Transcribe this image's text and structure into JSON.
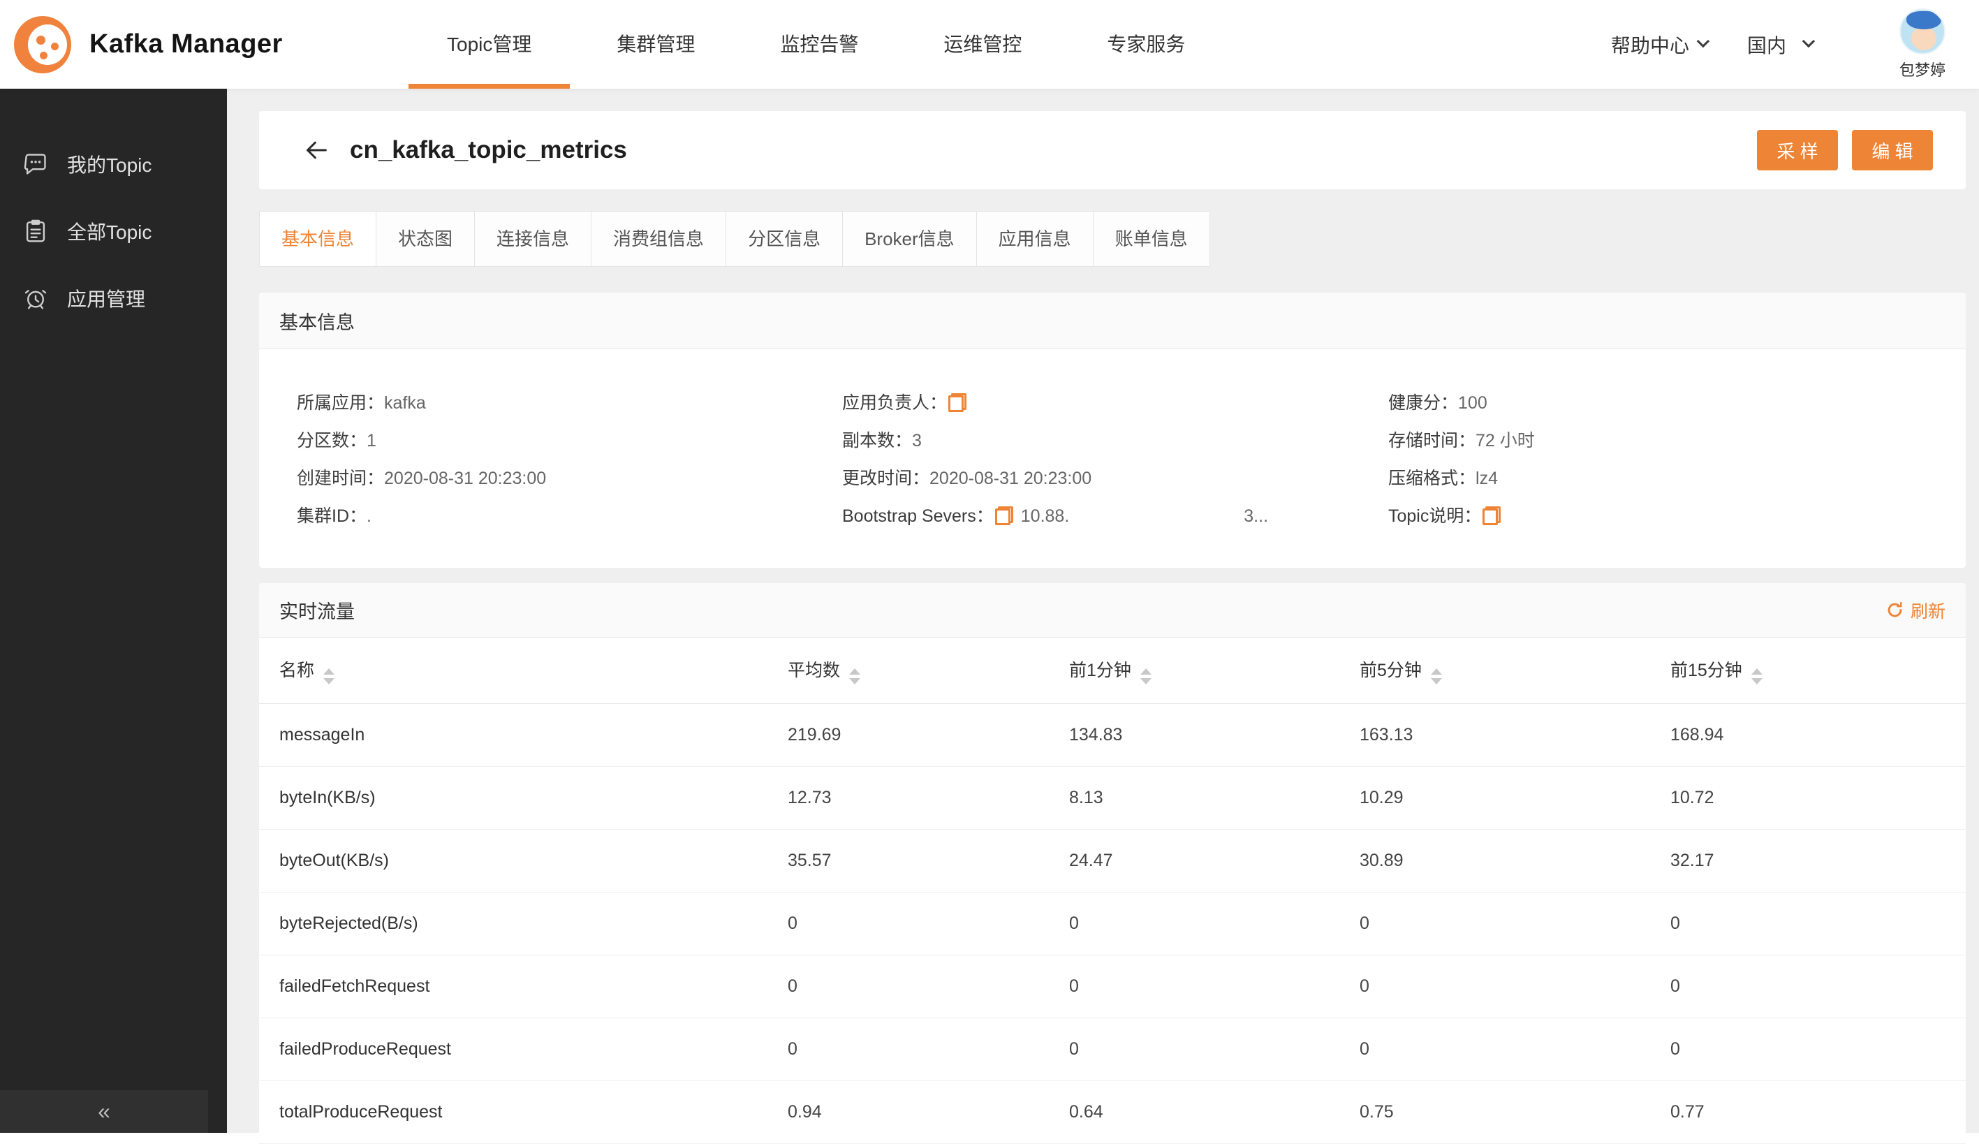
{
  "colors": {
    "accent": "#EE8435",
    "sidebar_bg": "#262626",
    "page_bg": "#EFEFEF"
  },
  "navbar": {
    "brand": "Kafka Manager",
    "items": [
      {
        "label": "Topic管理",
        "active": true
      },
      {
        "label": "集群管理",
        "active": false
      },
      {
        "label": "监控告警",
        "active": false
      },
      {
        "label": "运维管控",
        "active": false
      },
      {
        "label": "专家服务",
        "active": false
      }
    ],
    "help": "帮助中心",
    "region": "国内",
    "user": "包梦婷"
  },
  "sidebar": {
    "items": [
      {
        "label": "我的Topic",
        "icon": "comment-icon"
      },
      {
        "label": "全部Topic",
        "icon": "clipboard-icon"
      },
      {
        "label": "应用管理",
        "icon": "app-manage-icon"
      }
    ],
    "collapse_glyph": "«"
  },
  "page": {
    "title": "cn_kafka_topic_metrics",
    "buttons": {
      "sample": "采 样",
      "edit": "编 辑"
    },
    "tabs": [
      "基本信息",
      "状态图",
      "连接信息",
      "消费组信息",
      "分区信息",
      "Broker信息",
      "应用信息",
      "账单信息"
    ],
    "active_tab": 0
  },
  "basic_info": {
    "section_title": "基本信息",
    "fields": [
      {
        "label": "所属应用",
        "value": "kafka"
      },
      {
        "label": "应用负责人",
        "value": "",
        "copy": true
      },
      {
        "label": "健康分",
        "value": "100"
      },
      {
        "label": "分区数",
        "value": "1"
      },
      {
        "label": "副本数",
        "value": "3"
      },
      {
        "label": "存储时间",
        "value": "72 小时"
      },
      {
        "label": "创建时间",
        "value": "2020-08-31 20:23:00"
      },
      {
        "label": "更改时间",
        "value": "2020-08-31 20:23:00"
      },
      {
        "label": "压缩格式",
        "value": "lz4"
      },
      {
        "label": "集群ID",
        "value": "."
      },
      {
        "label": "Bootstrap Severs",
        "value": "10.88.",
        "value2": "3...",
        "copy": true
      },
      {
        "label": "Topic说明",
        "value": "",
        "copy": true
      }
    ]
  },
  "realtime": {
    "section_title": "实时流量",
    "refresh_label": "刷新",
    "table": {
      "columns": [
        "名称",
        "平均数",
        "前1分钟",
        "前5分钟",
        "前15分钟"
      ],
      "rows": [
        [
          "messageIn",
          "219.69",
          "134.83",
          "163.13",
          "168.94"
        ],
        [
          "byteIn(KB/s)",
          "12.73",
          "8.13",
          "10.29",
          "10.72"
        ],
        [
          "byteOut(KB/s)",
          "35.57",
          "24.47",
          "30.89",
          "32.17"
        ],
        [
          "byteRejected(B/s)",
          "0",
          "0",
          "0",
          "0"
        ],
        [
          "failedFetchRequest",
          "0",
          "0",
          "0",
          "0"
        ],
        [
          "failedProduceRequest",
          "0",
          "0",
          "0",
          "0"
        ],
        [
          "totalProduceRequest",
          "0.94",
          "0.64",
          "0.75",
          "0.77"
        ]
      ]
    }
  }
}
